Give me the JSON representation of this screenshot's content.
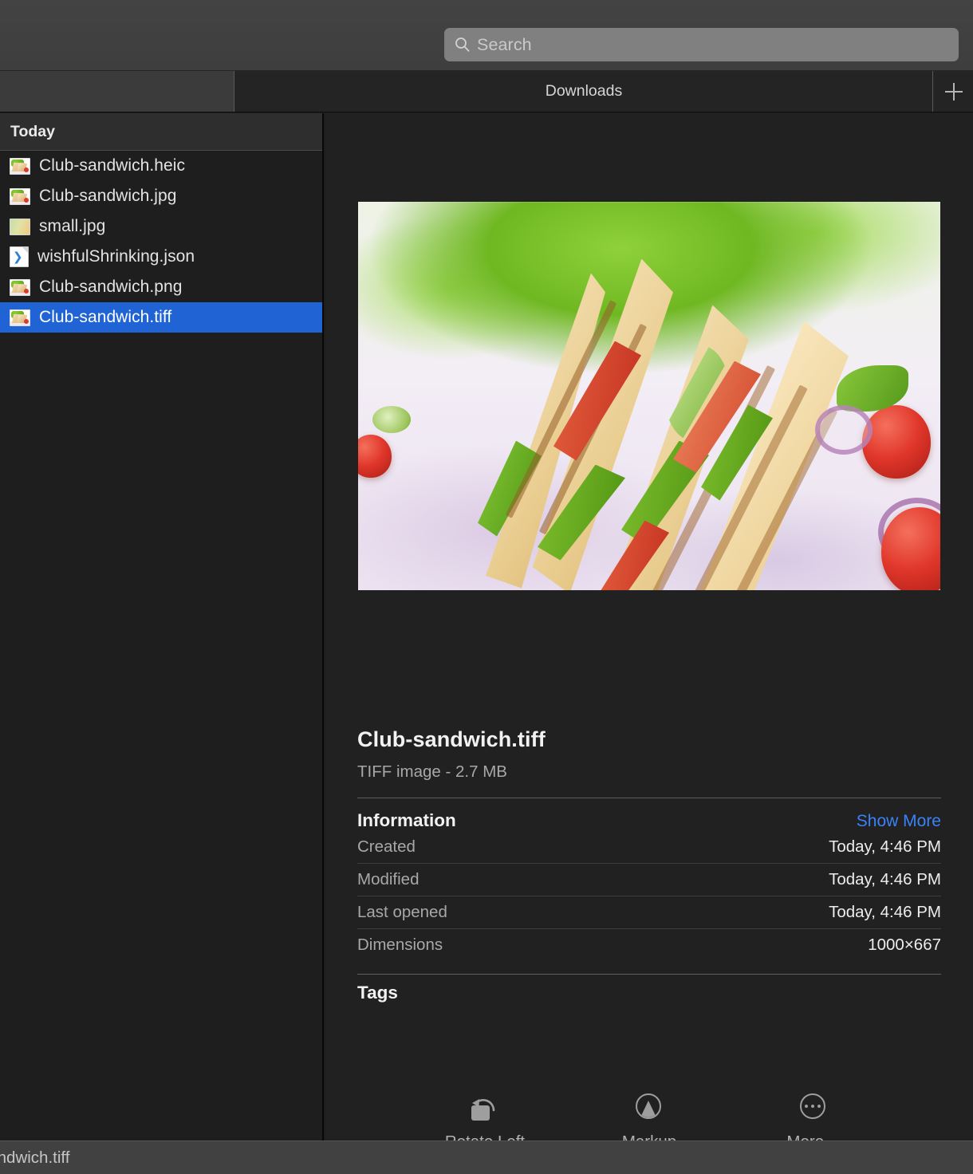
{
  "window": {
    "app_kind": "file-preview-window"
  },
  "search": {
    "placeholder": "Search",
    "value": "",
    "icon": "search-icon"
  },
  "tabs": {
    "active_label": "Downloads",
    "add_icon": "plus-icon"
  },
  "sidebar": {
    "group_header": "Today",
    "items": [
      {
        "name": "Club-sandwich.heic",
        "icon": "image-thumbnail-icon",
        "selected": false
      },
      {
        "name": "Club-sandwich.jpg",
        "icon": "image-thumbnail-icon",
        "selected": false
      },
      {
        "name": "small.jpg",
        "icon": "image-gradient-thumbnail-icon",
        "selected": false
      },
      {
        "name": "wishfulShrinking.json",
        "icon": "vscode-document-icon",
        "selected": false
      },
      {
        "name": "Club-sandwich.png",
        "icon": "image-thumbnail-icon",
        "selected": false
      },
      {
        "name": "Club-sandwich.tiff",
        "icon": "image-thumbnail-icon",
        "selected": true
      }
    ],
    "selection_color": "#1f63d4"
  },
  "detail": {
    "preview_alt": "Club sandwich triangles with lettuce, tomato and onion",
    "title": "Club-sandwich.tiff",
    "subtitle": "TIFF image - 2.7 MB",
    "section_title": "Information",
    "section_action": "Show More",
    "action_color": "#3b82f7",
    "rows": [
      {
        "label": "Created",
        "value": "Today, 4:46 PM"
      },
      {
        "label": "Modified",
        "value": "Today, 4:46 PM"
      },
      {
        "label": "Last opened",
        "value": "Today, 4:46 PM"
      },
      {
        "label": "Dimensions",
        "value": "1000×667"
      }
    ],
    "tags_title": "Tags"
  },
  "actions": [
    {
      "label": "Rotate Left",
      "icon": "rotate-left-icon"
    },
    {
      "label": "Markup",
      "icon": "markup-icon"
    },
    {
      "label": "More…",
      "icon": "more-ellipsis-icon"
    }
  ],
  "statusbar": {
    "text": "Club-sandwich.tiff"
  }
}
